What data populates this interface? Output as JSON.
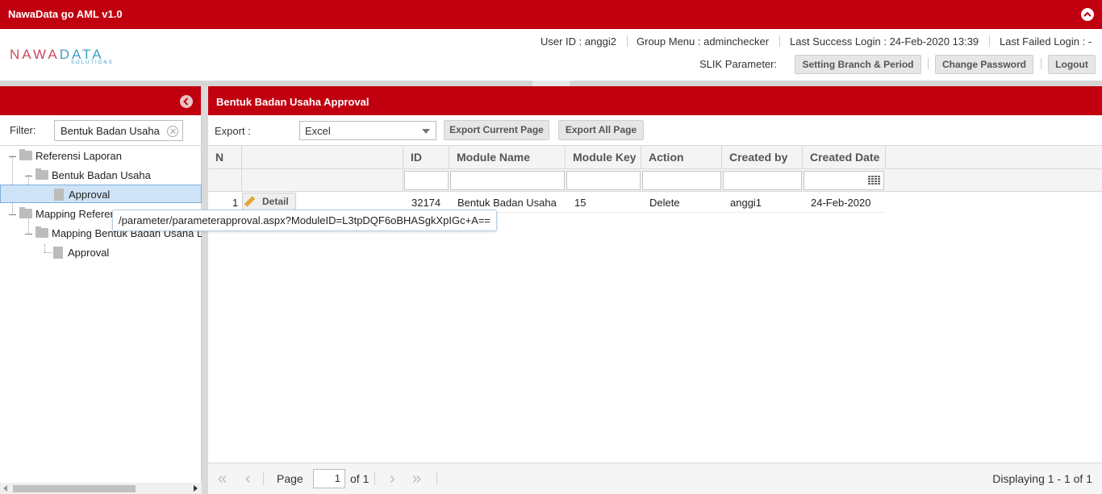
{
  "app": {
    "title": "NawaData go AML v1.0"
  },
  "logo": {
    "brand_a": "NAWA",
    "brand_b": "DATA",
    "sub": "SOLUTIONS"
  },
  "header": {
    "user_id": "User ID : anggi2",
    "group_menu": "Group Menu : adminchecker",
    "last_success": "Last Success Login : 24-Feb-2020 13:39",
    "last_failed": "Last Failed Login : -",
    "slik_label": "SLIK Parameter:",
    "btn_branch": "Setting Branch & Period",
    "btn_password": "Change Password",
    "btn_logout": "Logout"
  },
  "left": {
    "filter_label": "Filter:",
    "filter_value": "Bentuk Badan Usaha",
    "tree": [
      {
        "label": "Referensi Laporan"
      },
      {
        "label": "Bentuk Badan Usaha"
      },
      {
        "label": "Approval"
      },
      {
        "label": "Mapping Referensi Laporan"
      },
      {
        "label": "Mapping Bentuk Badan Usaha Laporan"
      },
      {
        "label": "Approval"
      }
    ]
  },
  "main": {
    "title": "Bentuk Badan Usaha Approval",
    "export_label": "Export :",
    "export_value": "Excel",
    "btn_export_current": "Export Current Page",
    "btn_export_all": "Export All Page",
    "columns": [
      "N",
      "ID",
      "Module Name",
      "Module Key",
      "Action",
      "Created by",
      "Created Date"
    ],
    "rows": [
      {
        "n": "1",
        "detail": "Detail",
        "id": "32174",
        "module_name": "Bentuk Badan Usaha",
        "module_key": "15",
        "action": "Delete",
        "created_by": "anggi1",
        "created_date": "24-Feb-2020"
      }
    ],
    "tooltip": "/parameter/parameterapproval.aspx?ModuleID=L3tpDQF6oBHASgkXpIGc+A==",
    "pager": {
      "page_label": "Page",
      "page_value": "1",
      "of_label": "of 1",
      "displaying": "Displaying 1 - 1 of 1"
    }
  },
  "colors": {
    "brand_red": "#c1000f",
    "selection": "#cfe3f6"
  }
}
